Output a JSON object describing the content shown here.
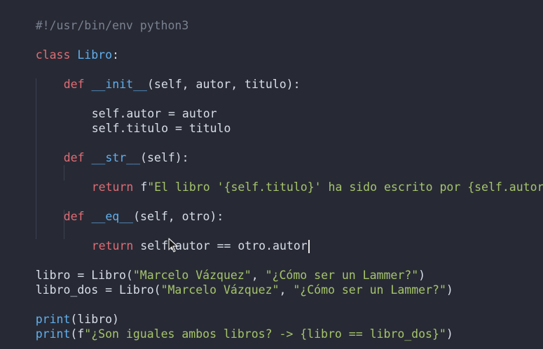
{
  "colors": {
    "background": "#272a34",
    "keyword": "#e06c75",
    "name": "#61afef",
    "string": "#a6c46c",
    "comment": "#7a8190",
    "text": "#d8dee9"
  },
  "code": {
    "l1": "#!/usr/bin/env python3",
    "l3_kw": "class",
    "l3_name": "Libro",
    "l3_rest": ":",
    "l5_kw": "def",
    "l5_name": "__init__",
    "l5_rest": "(self, autor, titulo):",
    "l7": "self.autor = autor",
    "l8": "self.titulo = titulo",
    "l10_kw": "def",
    "l10_name": "__str__",
    "l10_rest": "(self):",
    "l12_kw": "return",
    "l12_rest": " f",
    "l12_str": "\"El libro '{self.titulo}' ha sido escrito por {self.autor}\"",
    "l14_kw": "def",
    "l14_name": "__eq__",
    "l14_rest": "(self, otro):",
    "l16_kw": "return",
    "l16_rest": " self.autor == otro.autor",
    "l18_a": "libro = Libro(",
    "l18_s1": "\"Marcelo Vázquez\"",
    "l18_b": ", ",
    "l18_s2": "\"¿Cómo ser un Lammer?\"",
    "l18_c": ")",
    "l19_a": "libro_dos = Libro(",
    "l19_s1": "\"Marcelo Vázquez\"",
    "l19_b": ", ",
    "l19_s2": "\"¿Cómo ser un Lammer?\"",
    "l19_c": ")",
    "l21_fn": "print",
    "l21_rest": "(libro)",
    "l22_fn": "print",
    "l22_a": "(f",
    "l22_s": "\"¿Son iguales ambos libros? -> {libro == libro_dos}\"",
    "l22_c": ")"
  }
}
